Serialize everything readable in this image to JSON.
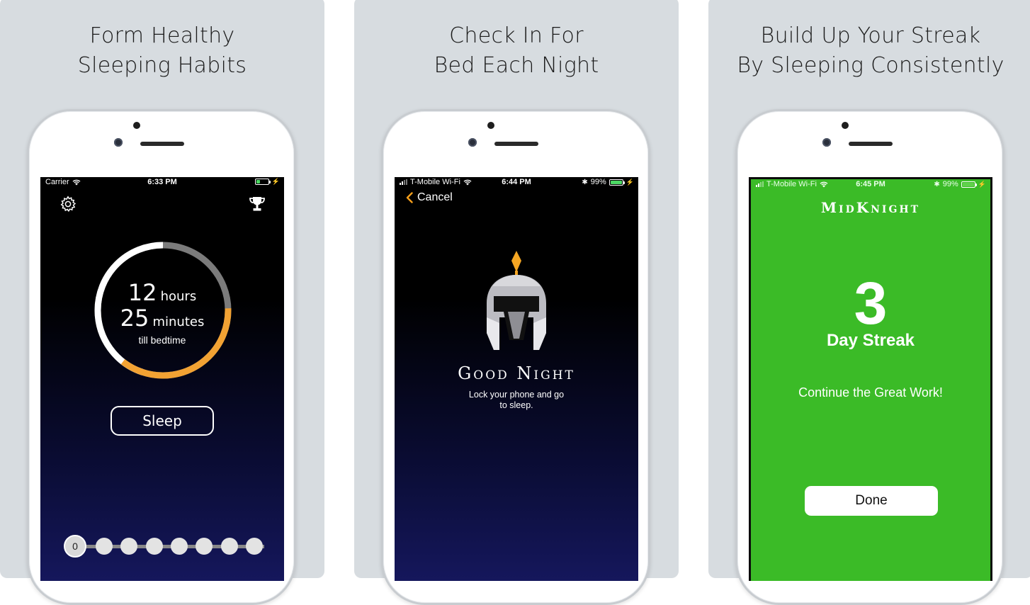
{
  "colors": {
    "panel_bg": "#d7dce0",
    "ring_orange": "#f2a233",
    "ring_gray": "#7b7b7b",
    "streak_green": "#3bbb27",
    "accent_orange": "#f59e1b"
  },
  "panel1": {
    "caption_line1": "Form Healthy",
    "caption_line2": "Sleeping Habits",
    "status": {
      "carrier": "Carrier",
      "time": "6:33 PM"
    },
    "icons": {
      "settings": "gear-icon",
      "achievements": "trophy-icon"
    },
    "countdown": {
      "hours_value": "12",
      "hours_label": "hours",
      "minutes_value": "25",
      "minutes_label": "minutes",
      "caption": "till bedtime",
      "elapsed_fraction": 0.45
    },
    "sleep_label": "Sleep",
    "streak_dots": {
      "current_label": "0",
      "count": 8
    }
  },
  "panel2": {
    "caption_line1": "Check In For",
    "caption_line2": "Bed Each Night",
    "status": {
      "carrier": "T-Mobile Wi-Fi",
      "time": "6:44 PM",
      "battery": "99%"
    },
    "cancel_label": "Cancel",
    "title": "Good Night",
    "message_line1": "Lock your phone and go",
    "message_line2": "to sleep."
  },
  "panel3": {
    "caption_line1": "Build Up Your Streak",
    "caption_line2": "By Sleeping Consistently",
    "status": {
      "carrier": "T-Mobile Wi-Fi",
      "time": "6:45 PM",
      "battery": "99%"
    },
    "brand": "MidKnight",
    "streak_count": "3",
    "streak_label": "Day Streak",
    "message": "Continue the Great Work!",
    "done_label": "Done"
  }
}
